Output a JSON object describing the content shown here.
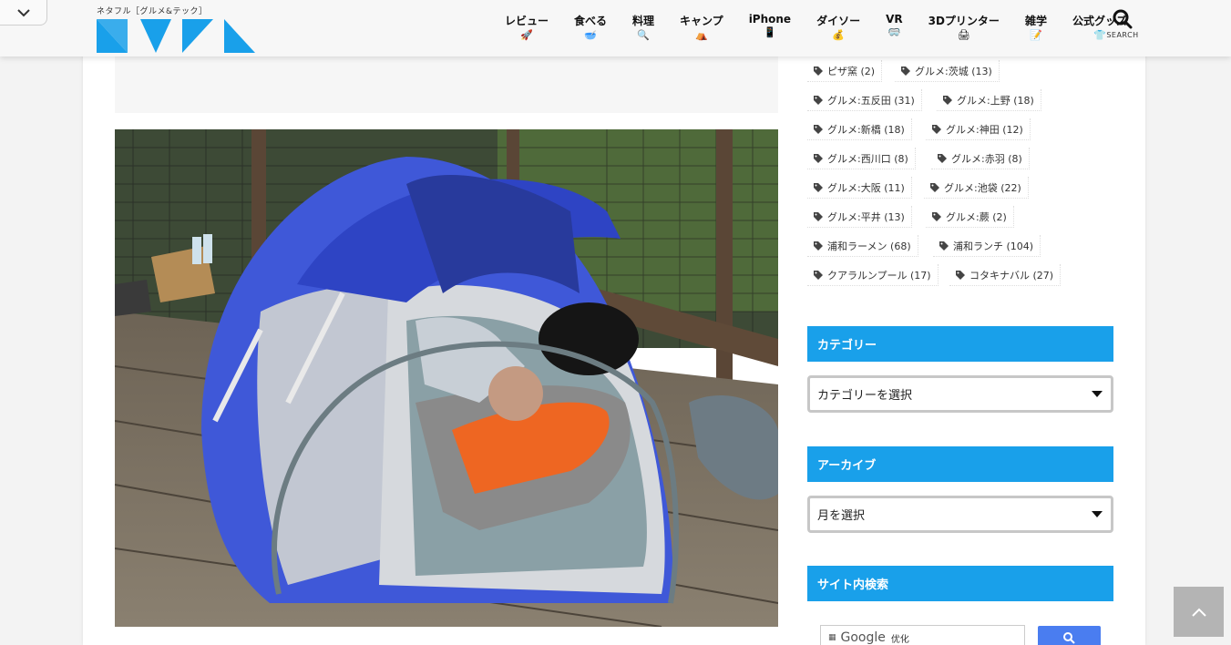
{
  "header": {
    "tagline": "ネタフル［グルメ&テック］",
    "nav": [
      {
        "label": "レビュー",
        "icon": "rocket-icon",
        "glyph": "🚀"
      },
      {
        "label": "食べる",
        "icon": "bowl-icon",
        "glyph": "🥣"
      },
      {
        "label": "料理",
        "icon": "magnifier-icon",
        "glyph": "🔍"
      },
      {
        "label": "キャンプ",
        "icon": "tent-icon",
        "glyph": "⛺"
      },
      {
        "label": "iPhone",
        "icon": "phone-icon",
        "glyph": "📱"
      },
      {
        "label": "ダイソー",
        "icon": "money-bag-icon",
        "glyph": "💰"
      },
      {
        "label": "VR",
        "icon": "goggles-icon",
        "glyph": "🥽"
      },
      {
        "label": "3Dプリンター",
        "icon": "printer-icon",
        "glyph": "🖨"
      },
      {
        "label": "雑学",
        "icon": "memo-icon",
        "glyph": "📝"
      },
      {
        "label": "公式グッズ",
        "icon": "tshirt-icon",
        "glyph": "👕"
      }
    ],
    "search_label": "SEARCH"
  },
  "tags": [
    {
      "label": "ピザ窯 (2)"
    },
    {
      "label": "グルメ:茨城 (13)"
    },
    {
      "label": "グルメ:五反田 (31)"
    },
    {
      "label": "グルメ:上野 (18)"
    },
    {
      "label": "グルメ:新橋 (18)"
    },
    {
      "label": "グルメ:神田 (12)"
    },
    {
      "label": "グルメ:西川口 (8)"
    },
    {
      "label": "グルメ:赤羽 (8)"
    },
    {
      "label": "グルメ:大阪 (11)"
    },
    {
      "label": "グルメ:池袋 (22)"
    },
    {
      "label": "グルメ:平井 (13)"
    },
    {
      "label": "グルメ:蕨 (2)"
    },
    {
      "label": "浦和ラーメン (68)"
    },
    {
      "label": "浦和ランチ (104)"
    },
    {
      "label": "クアラルンプール (17)"
    },
    {
      "label": "コタキナバル (27)"
    }
  ],
  "sidebar": {
    "category_title": "カテゴリー",
    "category_select": "カテゴリーを選択",
    "archive_title": "アーカイブ",
    "archive_select": "月を選択",
    "site_search_title": "サイト内検索",
    "google_label": "Google",
    "google_suffix": "优化"
  },
  "colors": {
    "accent": "#19a0ea",
    "logo_blue": "#19a0ea"
  }
}
